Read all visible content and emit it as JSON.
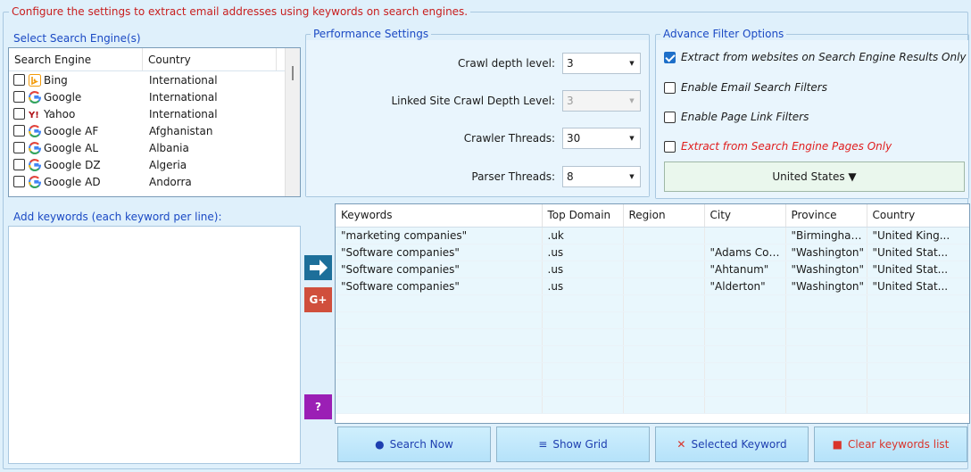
{
  "header": {
    "instruction": "Configure the settings to extract email addresses using keywords on search engines."
  },
  "engines": {
    "title": "Select Search Engine(s)",
    "columns": [
      "Search Engine",
      "Country"
    ],
    "rows": [
      {
        "name": "Bing",
        "country": "International",
        "icon": "bing-icon"
      },
      {
        "name": "Google",
        "country": "International",
        "icon": "google-icon"
      },
      {
        "name": "Yahoo",
        "country": "International",
        "icon": "yahoo-icon"
      },
      {
        "name": "Google AF",
        "country": "Afghanistan",
        "icon": "google-icon"
      },
      {
        "name": "Google AL",
        "country": "Albania",
        "icon": "google-icon"
      },
      {
        "name": "Google DZ",
        "country": "Algeria",
        "icon": "google-icon"
      },
      {
        "name": "Google AD",
        "country": "Andorra",
        "icon": "google-icon"
      }
    ]
  },
  "performance": {
    "title": "Performance Settings",
    "crawl_depth": {
      "label": "Crawl depth level:",
      "value": "3"
    },
    "linked_depth": {
      "label": "Linked Site Crawl Depth Level:",
      "value": "3"
    },
    "crawler_threads": {
      "label": "Crawler Threads:",
      "value": "30"
    },
    "parser_threads": {
      "label": "Parser Threads:",
      "value": "8"
    }
  },
  "filters": {
    "title": "Advance Filter Options",
    "opt1": {
      "label": "Extract from websites on Search Engine Results Only",
      "checked": true
    },
    "opt2": {
      "label": "Enable Email Search Filters",
      "checked": false
    },
    "opt3": {
      "label": "Enable Page Link Filters",
      "checked": false
    },
    "opt4": {
      "label": "Extract from Search Engine Pages Only",
      "checked": false
    },
    "country": "United States ▼"
  },
  "keywords": {
    "label": "Add keywords (each keyword per line):",
    "value": ""
  },
  "side_buttons": {
    "google_plus": "G+",
    "help": "?"
  },
  "grid": {
    "columns": [
      "Keywords",
      "Top Domain",
      "Region",
      "City",
      "Province",
      "Country"
    ],
    "rows": [
      [
        "\"marketing companies\"",
        ".uk",
        "",
        "",
        "\"Birmingham\"",
        "\"United King..."
      ],
      [
        "\"Software companies\"",
        ".us",
        "",
        "\"Adams Cou...",
        "\"Washington\"",
        "\"United Stat..."
      ],
      [
        "\"Software companies\"",
        ".us",
        "",
        "\"Ahtanum\"",
        "\"Washington\"",
        "\"United Stat..."
      ],
      [
        "\"Software companies\"",
        ".us",
        "",
        "\"Alderton\"",
        "\"Washington\"",
        "\"United Stat..."
      ]
    ],
    "empty_rows": 7
  },
  "buttons": {
    "search": "Search Now",
    "grid": "Show Grid",
    "selected": "Selected Keyword",
    "clear": "Clear keywords list"
  },
  "colors": {
    "accent": "#1a49c4",
    "warning": "#e01e1e",
    "page_bg": "#dff0fb"
  }
}
